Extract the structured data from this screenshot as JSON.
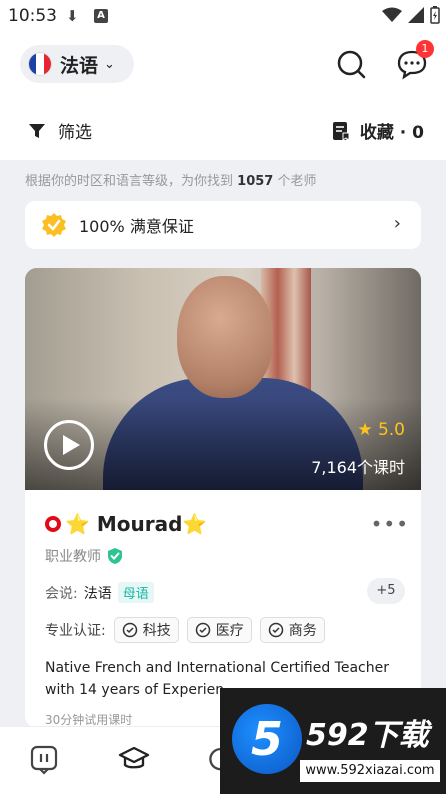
{
  "status_bar": {
    "time": "10:53",
    "a_badge": "A"
  },
  "header": {
    "language": "法语",
    "message_badge": "1"
  },
  "toolbar": {
    "filter_label": "筛选",
    "favorites_label": "收藏 · 0"
  },
  "results": {
    "prefix": "根据你的时区和语言等级，为你找到",
    "count": "1057",
    "suffix": "个老师"
  },
  "guarantee": {
    "label": "100% 满意保证"
  },
  "teacher": {
    "name": "⭐ Mourad⭐",
    "role": "职业教师",
    "rating": "★ 5.0",
    "lessons": "7,164个课时",
    "speaks_label": "会说:",
    "speaks_lang": "法语",
    "native_tag": "母语",
    "more_langs": "+5",
    "cert_label": "专业认证:",
    "certs": [
      "科技",
      "医疗",
      "商务"
    ],
    "description": "Native French and International Certified Teacher with 14 years of Experien",
    "trial": "30分钟试用课时"
  },
  "watermark": {
    "logo_digit": "5",
    "brand": "592下载",
    "url": "www.592xiazai.com"
  },
  "colors": {
    "accent": "#ff3b30",
    "native_tag": "#14b8a6",
    "star": "#ffc31a"
  }
}
